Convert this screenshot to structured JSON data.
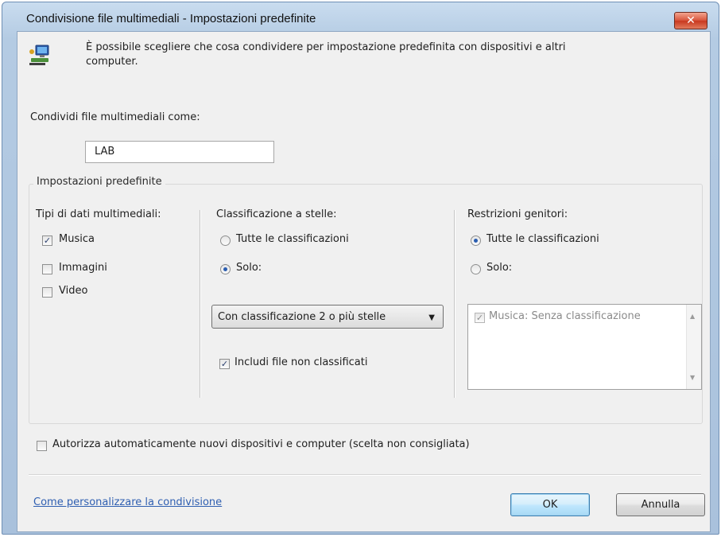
{
  "window": {
    "title": "Condivisione file multimediali - Impostazioni predefinite",
    "close_symbol": "✕"
  },
  "intro": {
    "icon": "network-computer-icon",
    "text_line1": "È possibile scegliere che cosa condividere per impostazione predefinita con dispositivi e altri",
    "text_line2": "computer."
  },
  "share_as": {
    "label": "Condividi file multimediali come:",
    "value": "LAB"
  },
  "defaults_group": {
    "label": "Impostazioni predefinite",
    "media_types": {
      "label": "Tipi di dati multimediali:",
      "items": [
        {
          "label": "Musica",
          "checked": true
        },
        {
          "label": "Immagini",
          "checked": false
        },
        {
          "label": "Video",
          "checked": false
        }
      ]
    },
    "star_rating": {
      "label": "Classificazione a stelle:",
      "options": [
        {
          "label": "Tutte le classificazioni",
          "selected": false
        },
        {
          "label": "Solo:",
          "selected": true
        }
      ],
      "combo_value": "Con classificazione 2 o più stelle",
      "include_unrated": {
        "label": "Includi file non classificati",
        "checked": true
      }
    },
    "parental": {
      "label": "Restrizioni genitori:",
      "options": [
        {
          "label": "Tutte le classificazioni",
          "selected": true
        },
        {
          "label": "Solo:",
          "selected": false
        }
      ],
      "list_items": [
        {
          "label": "Musica: Senza classificazione",
          "checked": true
        }
      ]
    }
  },
  "auto_authorize": {
    "label": "Autorizza automaticamente nuovi dispositivi e computer (scelta non consigliata)",
    "checked": false
  },
  "footer": {
    "help_link": "Come personalizzare la condivisione",
    "ok_label": "OK",
    "cancel_label": "Annulla"
  },
  "colors": {
    "accent": "#2a5db0",
    "link": "#2f5fb1"
  }
}
